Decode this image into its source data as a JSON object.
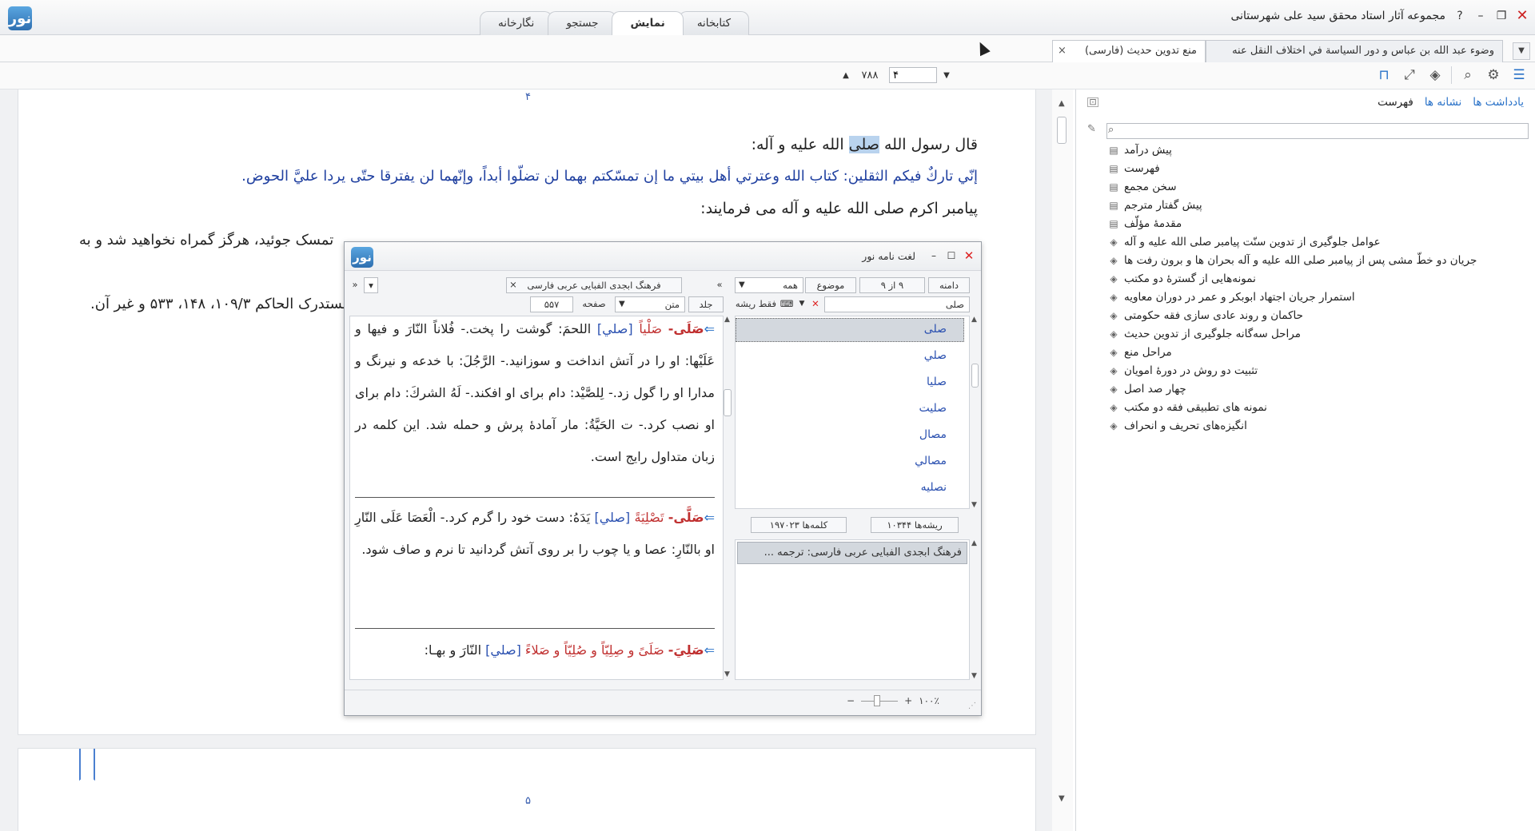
{
  "window": {
    "title": "مجموعه آثار استاد محقق سید علی شهرستانی",
    "help_icon": "?",
    "minimize": "–",
    "restore": "❐",
    "close": "✕"
  },
  "main_tabs": [
    "کتابخانه",
    "نمایش",
    "جستجو",
    "نگارخانه"
  ],
  "doc_tabs": {
    "active": "منع تدوین حدیث (فارسی)",
    "other": "وضوء عبد الله بن عباس و دور السیاسة في اختلاف النقل عنه",
    "close": "×"
  },
  "pager": {
    "current_page": "۴",
    "total_pages": "۷۸۸"
  },
  "page": {
    "page_number_top": "۴",
    "page_number_bottom": "۵",
    "line1_before": "قال رسول الله ",
    "line1_highlight": "صلی",
    "line1_after": " الله علیه و آله:",
    "hadith": "إنّي تاركٌ فيكم الثقلين: كتاب الله وعترتي أهل بيتي ما إن تمسّكتم بهما لن تضلّوا أبداً، وإنّهما لن يفترقا حتّى يردا عليَّ الحوض.",
    "line3": "پیامبر اکرم صلی الله علیه و آله می فرمایند:",
    "partial_line4": "تمسک جوئید، هرگز گمراه نخواهید شد و به",
    "partial_line5": "مستدرک الحاکم ۱۰۹/۳، ۱۴۸، ۵۳۳ و غیر آن."
  },
  "sidebar": {
    "tabs": [
      "فهرست",
      "نشانه ها",
      "یادداشت ها"
    ],
    "toc": [
      {
        "label": "پیش درآمد",
        "icon": "page-icon"
      },
      {
        "label": "فهرست",
        "icon": "page-icon"
      },
      {
        "label": "سخن مجمع",
        "icon": "page-icon"
      },
      {
        "label": "پیش گفتار مترجم",
        "icon": "page-icon"
      },
      {
        "label": "مقدمهٔ مؤلّف",
        "icon": "page-icon"
      },
      {
        "label": "عوامل جلوگیری از تدوین سنّت پیامبر صلی الله علیه و آله",
        "icon": "layers-icon"
      },
      {
        "label": "جریان دو خطّ مشی پس از پیامبر صلی الله علیه و آله بحران ها و برون رفت ها",
        "icon": "layers-icon"
      },
      {
        "label": "نمونه‌هایی از گسترهٔ دو مکتب",
        "icon": "layers-icon"
      },
      {
        "label": "استمرار جریان اجتهاد ابوبکر و عمر در دوران معاویه",
        "icon": "layers-icon"
      },
      {
        "label": "حاکمان و روند عادی سازی فقه حکومتی",
        "icon": "layers-icon"
      },
      {
        "label": "مراحل سه‌گانه جلوگیری از تدوین حدیث",
        "icon": "layers-icon"
      },
      {
        "label": "مراحل منع",
        "icon": "layers-icon"
      },
      {
        "label": "تثبیت دو روش در دورهٔ امویان",
        "icon": "layers-icon"
      },
      {
        "label": "چهار صد اصل",
        "icon": "layers-icon"
      },
      {
        "label": "نمونه های تطبیقی فقه دو مکتب",
        "icon": "layers-icon"
      },
      {
        "label": "انگیزه‌های تحریف و انحراف",
        "icon": "layers-icon"
      }
    ]
  },
  "dictionary": {
    "title": "لغت نامه نور",
    "source_tab": "فرهنگ ابجدی الفبایی عربی فارسی",
    "domain_btn": "دامنه",
    "count": "۹ از ۹",
    "topic_btn": "موضوع",
    "topic_value": "همه",
    "search_value": "صلی",
    "root_only": "فقط ریشه",
    "volume_label": "جلد",
    "text_label": "متن",
    "page_label": "صفحه",
    "page_value": "۵۵۷",
    "words": [
      "صلی",
      "صلي",
      "صليا",
      "صليت",
      "مصال",
      "مصالي",
      "نصليه"
    ],
    "roots_label": "ریشه‌ها",
    "roots_count": "۱۰۳۴۴",
    "words_label": "کلمه‌ها",
    "words_count": "۱۹۷۰۲۳",
    "source_item": "فرهنگ ابجدی الفبایی عربی فارسی: ترجمه ...",
    "zoom": "۱۰۰٪",
    "entry1": {
      "head": "صَلَى-",
      "head2": " صَلْياً ",
      "tag": "[صلي]",
      "text": " اللحمَ: گوشت را پخت.- فُلاناً النّارَ و فيها و عَلَيْها: او را در آتش انداخت و سوزانيد.- الرَّجُلَ: با خدعه و نيرنگ و مدارا او را گول زد.- لِلصَّيْد: دام براى او افكند.- لَهُ الشركَ: دام براى او نصب كرد.- ت الحَيَّةُ: مار آمادهٔ پرش و حمله شد. اين كلمه در زبان متداول رايج است."
    },
    "entry2": {
      "head": "صَلَّى-",
      "head2": " تَصْلِيَةً ",
      "tag": "[صلي]",
      "text": " يَدَهُ: دست خود را گرم كرد.- الْعَصَا عَلَى النّارِ او بالنّارِ: عصا و يا چوب را بر روى آتش گردانيد تا نرم و صاف شود."
    },
    "entry3": {
      "head": "صَلِيَ-",
      "head2": " صَلَىً و صِلِيّاً و صُلِيّاً و صَلاءً ",
      "tag": "[صلي]",
      "text": " النّارَ و بهـا:"
    }
  }
}
